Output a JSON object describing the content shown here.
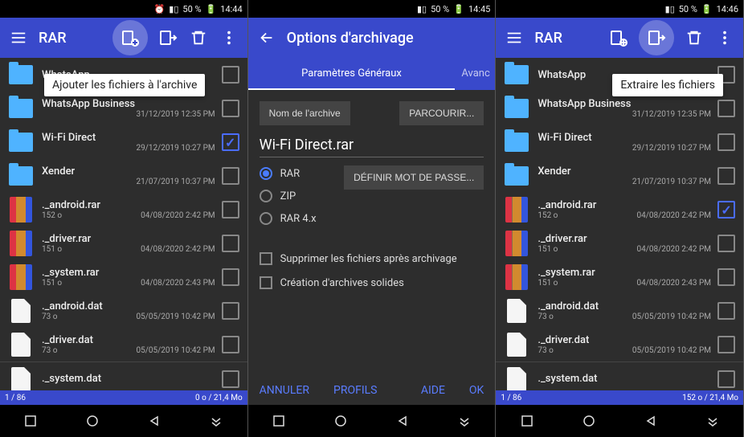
{
  "status": {
    "battery": "50 %",
    "t1": "14:44",
    "t2": "14:45",
    "t3": "14:46"
  },
  "app": {
    "title": "RAR"
  },
  "p1": {
    "tooltip": "Ajouter les fichiers à l'archive",
    "footer_left": "1 / 86",
    "footer_right": "0 o / 21,4 Mo"
  },
  "files": [
    {
      "name": "WhatsApp",
      "date": "",
      "size": "",
      "type": "folder",
      "checked": false
    },
    {
      "name": "WhatsApp Business",
      "date": "31/12/2019 12:35 PM",
      "size": "",
      "type": "folder",
      "checked": false
    },
    {
      "name": "Wi-Fi Direct",
      "date": "29/12/2019 10:27 PM",
      "size": "",
      "type": "folder",
      "checked": true
    },
    {
      "name": "Xender",
      "date": "21/07/2019 10:37 PM",
      "size": "",
      "type": "folder",
      "checked": false
    },
    {
      "name": "._android.rar",
      "date": "04/08/2020 2:42 PM",
      "size": "152 o",
      "type": "rar",
      "checked": false
    },
    {
      "name": "._driver.rar",
      "date": "04/08/2020 2:42 PM",
      "size": "151 o",
      "type": "rar",
      "checked": false
    },
    {
      "name": "._system.rar",
      "date": "04/08/2020 2:43 PM",
      "size": "151 o",
      "type": "rar",
      "checked": false
    },
    {
      "name": "._android.dat",
      "date": "05/05/2019 10:42 PM",
      "size": "73 o",
      "type": "doc",
      "checked": false
    },
    {
      "name": "._driver.dat",
      "date": "05/05/2019 10:42 PM",
      "size": "73 o",
      "type": "doc",
      "checked": false
    },
    {
      "name": "._system.dat",
      "date": "",
      "size": "",
      "type": "doc",
      "checked": false
    }
  ],
  "p2": {
    "title": "Options d'archivage",
    "tab1": "Paramètres Généraux",
    "tab2": "Avanc",
    "name_label": "Nom de l'archive",
    "browse": "PARCOURIR...",
    "archive_name": "Wi-Fi Direct.rar",
    "fmt_rar": "RAR",
    "fmt_zip": "ZIP",
    "fmt_rar4": "RAR 4.x",
    "set_pwd": "DÉFINIR MOT DE PASSE...",
    "delete_after": "Supprimer les fichiers après archivage",
    "solid": "Création d'archives solides",
    "cancel": "ANNULER",
    "profiles": "PROFILS",
    "help": "AIDE",
    "ok": "OK"
  },
  "p3": {
    "tooltip": "Extraire les fichiers",
    "footer_left": "1 / 86",
    "footer_right": "152 o / 21,4 Mo"
  },
  "files3": [
    {
      "name": "WhatsApp",
      "date": "",
      "size": "",
      "type": "folder",
      "checked": false
    },
    {
      "name": "WhatsApp Business",
      "date": "31/12/2019 12:35 PM",
      "size": "",
      "type": "folder",
      "checked": false
    },
    {
      "name": "Wi-Fi Direct",
      "date": "29/12/2019 10:27 PM",
      "size": "",
      "type": "folder",
      "checked": false
    },
    {
      "name": "Xender",
      "date": "21/07/2019 10:37 PM",
      "size": "",
      "type": "folder",
      "checked": false
    },
    {
      "name": "._android.rar",
      "date": "04/08/2020 2:42 PM",
      "size": "152 o",
      "type": "rar",
      "checked": true
    },
    {
      "name": "._driver.rar",
      "date": "04/08/2020 2:42 PM",
      "size": "151 o",
      "type": "rar",
      "checked": false
    },
    {
      "name": "._system.rar",
      "date": "04/08/2020 2:43 PM",
      "size": "151 o",
      "type": "rar",
      "checked": false
    },
    {
      "name": "._android.dat",
      "date": "05/05/2019 10:42 PM",
      "size": "73 o",
      "type": "doc",
      "checked": false
    },
    {
      "name": "._driver.dat",
      "date": "05/05/2019 10:42 PM",
      "size": "73 o",
      "type": "doc",
      "checked": false
    },
    {
      "name": "._system.dat",
      "date": "",
      "size": "",
      "type": "doc",
      "checked": false
    }
  ]
}
